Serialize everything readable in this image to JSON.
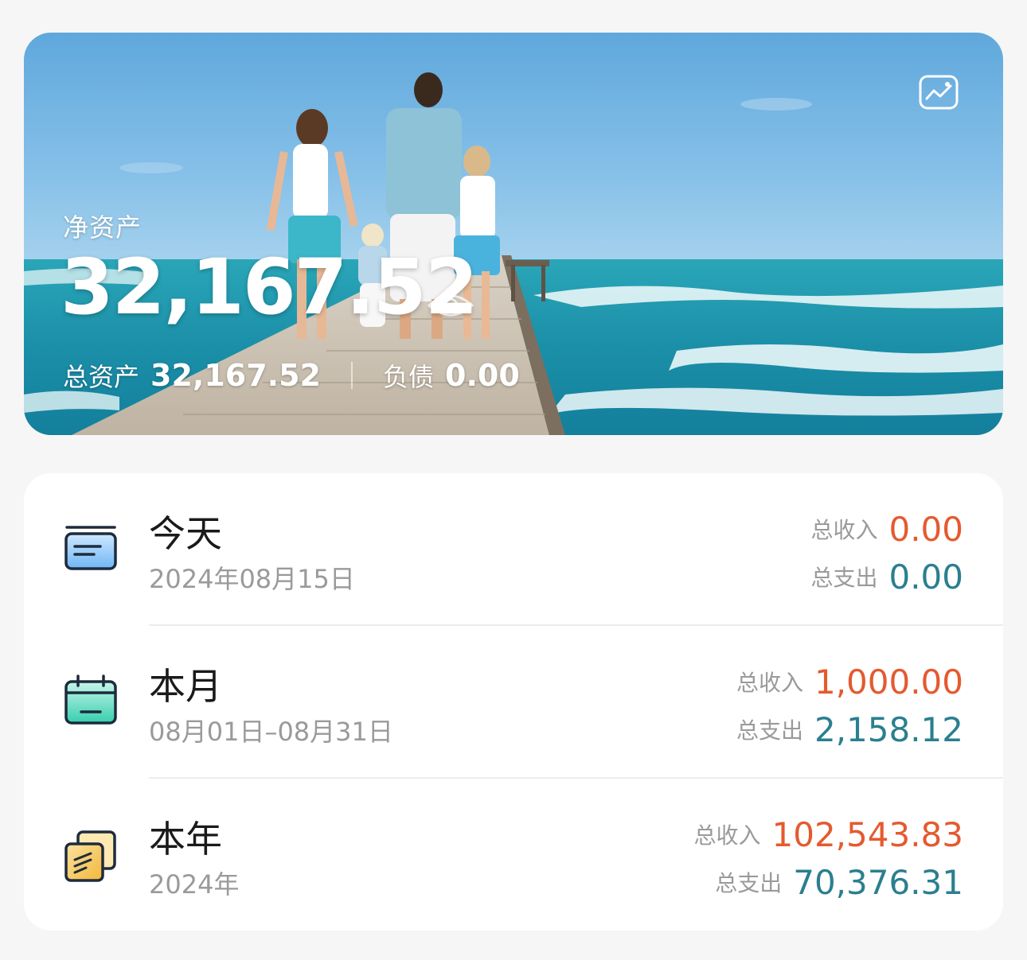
{
  "hero": {
    "label": "净资产",
    "net_assets": "32,167.52",
    "total_assets_label": "总资产",
    "total_assets": "32,167.52",
    "liabilities_label": "负债",
    "liabilities": "0.00",
    "image_button_icon": "image-icon",
    "visibility_icon": "eye-icon"
  },
  "summary": {
    "rows": [
      {
        "title": "今天",
        "subtitle": "2024年08月15日",
        "icon": "today-card-icon",
        "income_label": "总收入",
        "income": "0.00",
        "expense_label": "总支出",
        "expense": "0.00"
      },
      {
        "title": "本月",
        "subtitle": "08月01日–08月31日",
        "icon": "month-calendar-icon",
        "income_label": "总收入",
        "income": "1,000.00",
        "expense_label": "总支出",
        "expense": "2,158.12"
      },
      {
        "title": "本年",
        "subtitle": "2024年",
        "icon": "year-stack-icon",
        "income_label": "总收入",
        "income": "102,543.83",
        "expense_label": "总支出",
        "expense": "70,376.31"
      }
    ]
  },
  "colors": {
    "income": "#e45a2f",
    "expense": "#2a7f8f",
    "card_background": "#ffffff",
    "page_background": "#f6f6f6"
  }
}
